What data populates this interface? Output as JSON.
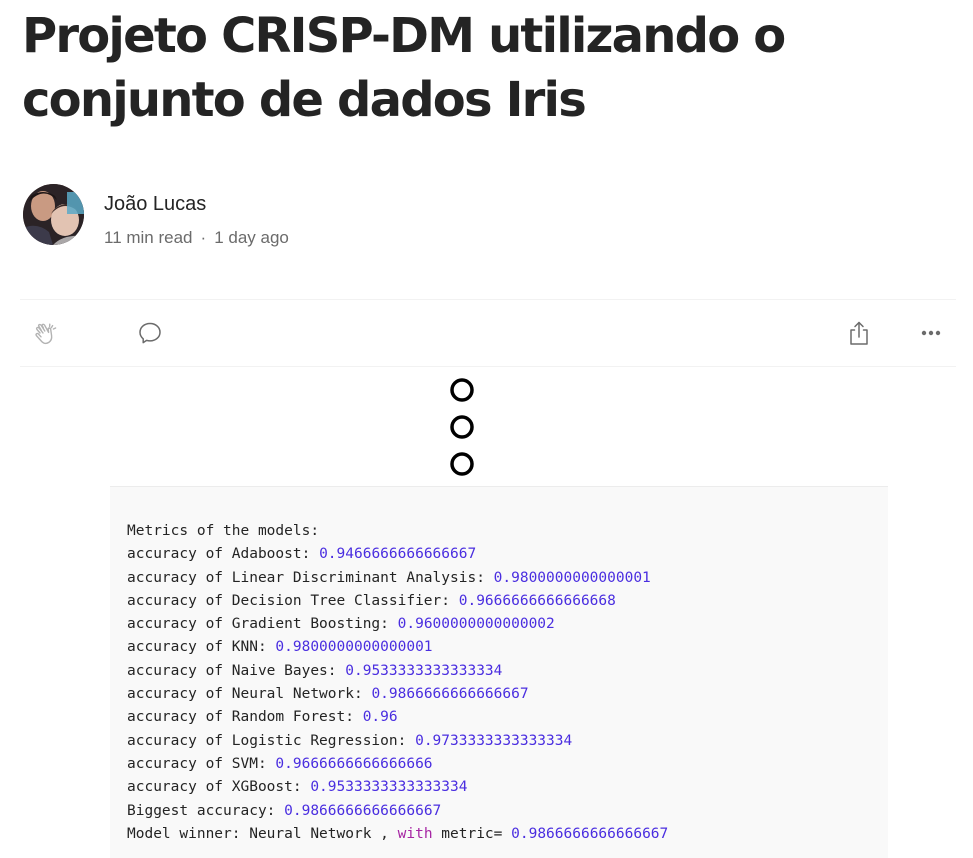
{
  "article": {
    "title": "Projeto CRISP-DM utilizando o conjunto de dados Iris",
    "author": "João Lucas",
    "read_time": "11 min read",
    "separator": "·",
    "published": "1 day ago"
  },
  "icons": {
    "clap": "clap-icon",
    "comment": "comment-icon",
    "share": "share-icon",
    "more": "more-icon"
  },
  "colors": {
    "number": "#4a2ee0",
    "keyword": "#a626a4",
    "code_background": "#f9f9f9"
  },
  "code": {
    "lines": [
      {
        "text": "Metrics of the models:",
        "value": ""
      },
      {
        "text": "accuracy of Adaboost: ",
        "value": "0.9466666666666667"
      },
      {
        "text": "accuracy of Linear Discriminant Analysis: ",
        "value": "0.9800000000000001"
      },
      {
        "text": "accuracy of Decision Tree Classifier: ",
        "value": "0.9666666666666668"
      },
      {
        "text": "accuracy of Gradient Boosting: ",
        "value": "0.9600000000000002"
      },
      {
        "text": "accuracy of KNN: ",
        "value": "0.9800000000000001"
      },
      {
        "text": "accuracy of Naive Bayes: ",
        "value": "0.9533333333333334"
      },
      {
        "text": "accuracy of Neural Network: ",
        "value": "0.9866666666666667"
      },
      {
        "text": "accuracy of Random Forest: ",
        "value": "0.96"
      },
      {
        "text": "accuracy of Logistic Regression: ",
        "value": "0.9733333333333334"
      },
      {
        "text": "accuracy of SVM: ",
        "value": "0.9666666666666666"
      },
      {
        "text": "accuracy of XGBoost: ",
        "value": "0.9533333333333334"
      },
      {
        "text": "Biggest accuracy: ",
        "value": "0.9866666666666667"
      }
    ],
    "winner": {
      "prefix": "Model winner: Neural Network , ",
      "keyword": "with",
      "middle": " metric= ",
      "value": "0.9866666666666667"
    }
  }
}
